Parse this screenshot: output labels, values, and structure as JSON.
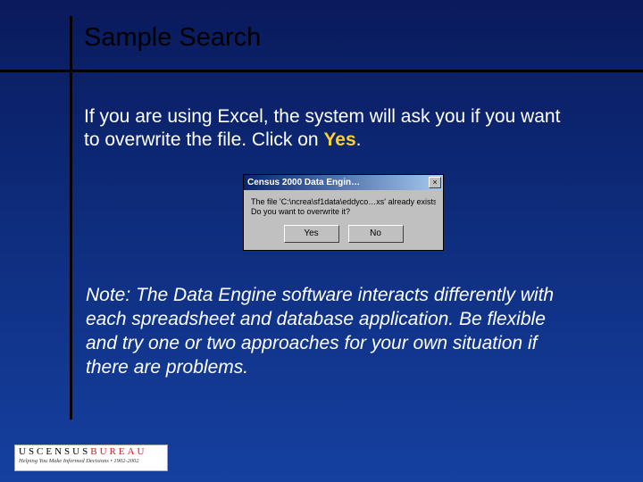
{
  "title": "Sample Search",
  "body": {
    "pre": "If you are using Excel, the system will ask you if you want to overwrite the file.  Click on ",
    "yes": "Yes",
    "post": "."
  },
  "dialog": {
    "title": "Census 2000 Data Engin…",
    "close_glyph": "×",
    "line1": "The file 'C:\\ncrea\\sf1data\\eddyco…xs' already exists.",
    "line2": "Do you want to overwrite it?",
    "yes_label": "Yes",
    "no_label": "No"
  },
  "note": "Note:  The Data Engine software interacts differently with each spreadsheet and database application.  Be flexible and try one or two approaches for your own situation if there are problems.",
  "footer": {
    "brand_pre": "USCENSUS",
    "brand_post": "BUREAU",
    "tagline": "Helping You Make Informed Decisions • 1902-2002"
  }
}
